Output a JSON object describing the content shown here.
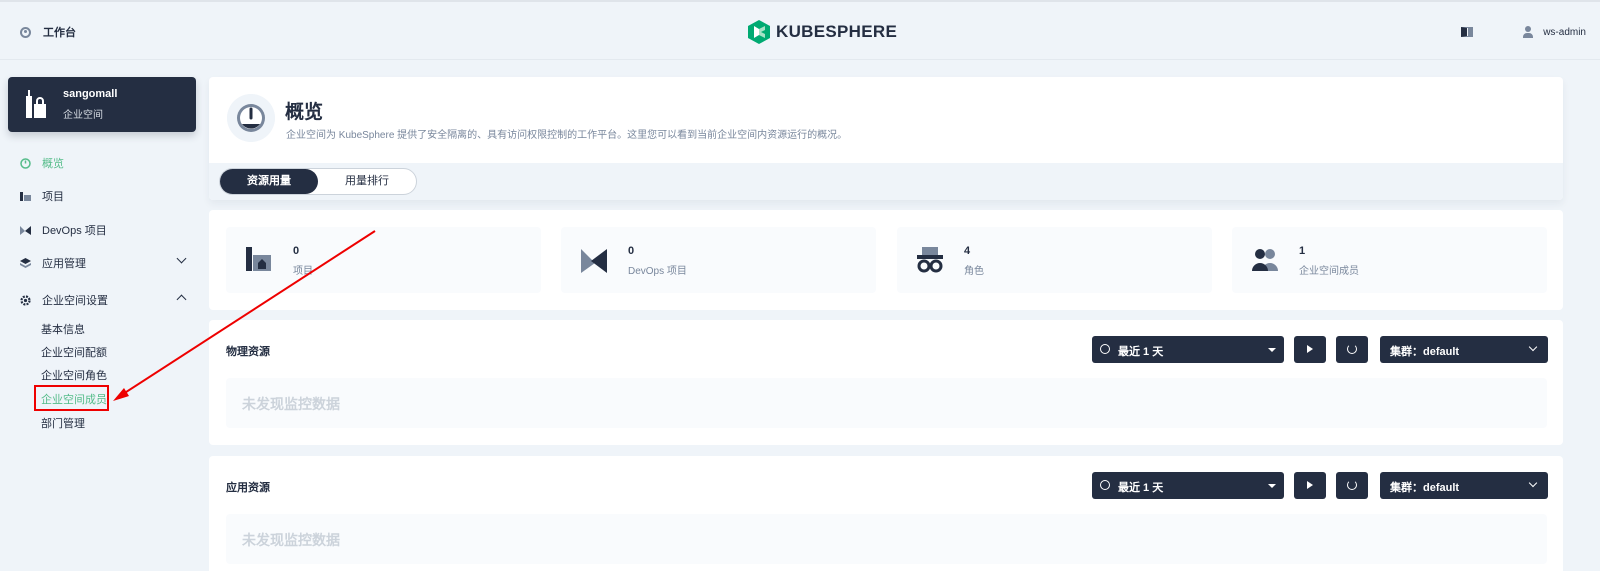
{
  "topbar": {
    "workbench_label": "工作台",
    "logo_text": "KUBESPHERE",
    "username": "ws-admin"
  },
  "workspace": {
    "name": "sangomall",
    "type": "企业空间"
  },
  "sidebar": {
    "items": [
      {
        "label": "概览",
        "icon": "overview-icon",
        "active": true
      },
      {
        "label": "项目",
        "icon": "project-icon"
      },
      {
        "label": "DevOps 项目",
        "icon": "devops-icon"
      },
      {
        "label": "应用管理",
        "icon": "app-management-icon",
        "expanded": false
      },
      {
        "label": "企业空间设置",
        "icon": "settings-gear-icon",
        "expanded": true
      }
    ],
    "sub_items": [
      {
        "label": "基本信息"
      },
      {
        "label": "企业空间配额"
      },
      {
        "label": "企业空间角色"
      },
      {
        "label": "企业空间成员",
        "active": true
      },
      {
        "label": "部门管理"
      }
    ]
  },
  "header": {
    "title": "概览",
    "description": "企业空间为 KubeSphere 提供了安全隔离的、具有访问权限控制的工作平台。这里您可以看到当前企业空间内资源运行的概况。",
    "tabs": [
      {
        "label": "资源用量",
        "active": true
      },
      {
        "label": "用量排行"
      }
    ]
  },
  "stats": [
    {
      "value": "0",
      "label": "项目",
      "icon": "project-icon"
    },
    {
      "value": "0",
      "label": "DevOps 项目",
      "icon": "devops-icon"
    },
    {
      "value": "4",
      "label": "角色",
      "icon": "role-icon"
    },
    {
      "value": "1",
      "label": "企业空间成员",
      "icon": "members-icon"
    }
  ],
  "panels": [
    {
      "title": "物理资源",
      "range": "最近 1 天",
      "cluster": "集群：default",
      "empty_text": "未发现监控数据"
    },
    {
      "title": "应用资源",
      "range": "最近 1 天",
      "cluster": "集群：default",
      "empty_text": "未发现监控数据"
    }
  ],
  "colors": {
    "accent": "#55bc8a",
    "dark": "#242e42",
    "annotation": "#e00000"
  }
}
